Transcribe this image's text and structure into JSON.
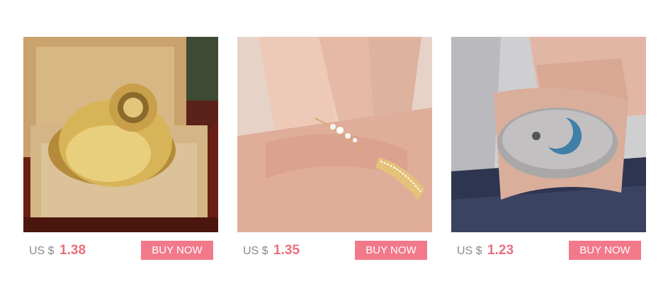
{
  "products": [
    {
      "image_icon": "gold-ring-in-box-image",
      "currency": "US $",
      "price": "1.38",
      "button_label": "BUY NOW"
    },
    {
      "image_icon": "rose-gold-leaf-ring-image",
      "currency": "US $",
      "price": "1.35",
      "button_label": "BUY NOW"
    },
    {
      "image_icon": "silver-moon-ring-image",
      "currency": "US $",
      "price": "1.23",
      "button_label": "BUY NOW"
    }
  ],
  "colors": {
    "price": "#e8707e",
    "button_bg": "#f2798a",
    "currency": "#8a8a8a"
  }
}
